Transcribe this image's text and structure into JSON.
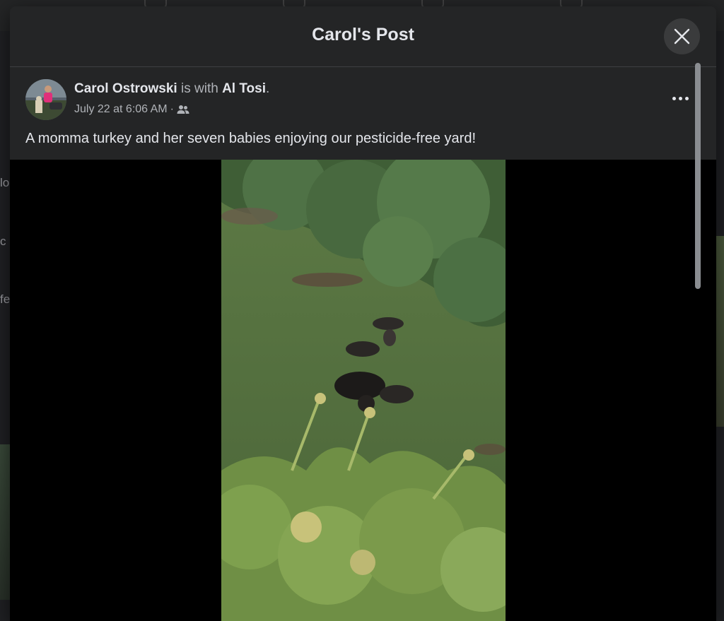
{
  "modal": {
    "title": "Carol's Post",
    "close_icon": "close-icon"
  },
  "post": {
    "author": "Carol Ostrowski",
    "with_text": "is with",
    "tagged": "Al Tosi",
    "period": ".",
    "timestamp": "July 22 at 6:06 AM",
    "separator": "·",
    "audience_icon": "friends-icon",
    "more_icon": "more-options-icon",
    "caption": "A momma turkey and her seven babies enjoying our pesticide-free yard!"
  },
  "background": {
    "left_fragments": [
      "lo",
      "c",
      "fe"
    ]
  },
  "colors": {
    "modal_bg": "#242526",
    "media_bg": "#000000",
    "text_primary": "#e4e6eb",
    "text_secondary": "#b0b3b8"
  }
}
